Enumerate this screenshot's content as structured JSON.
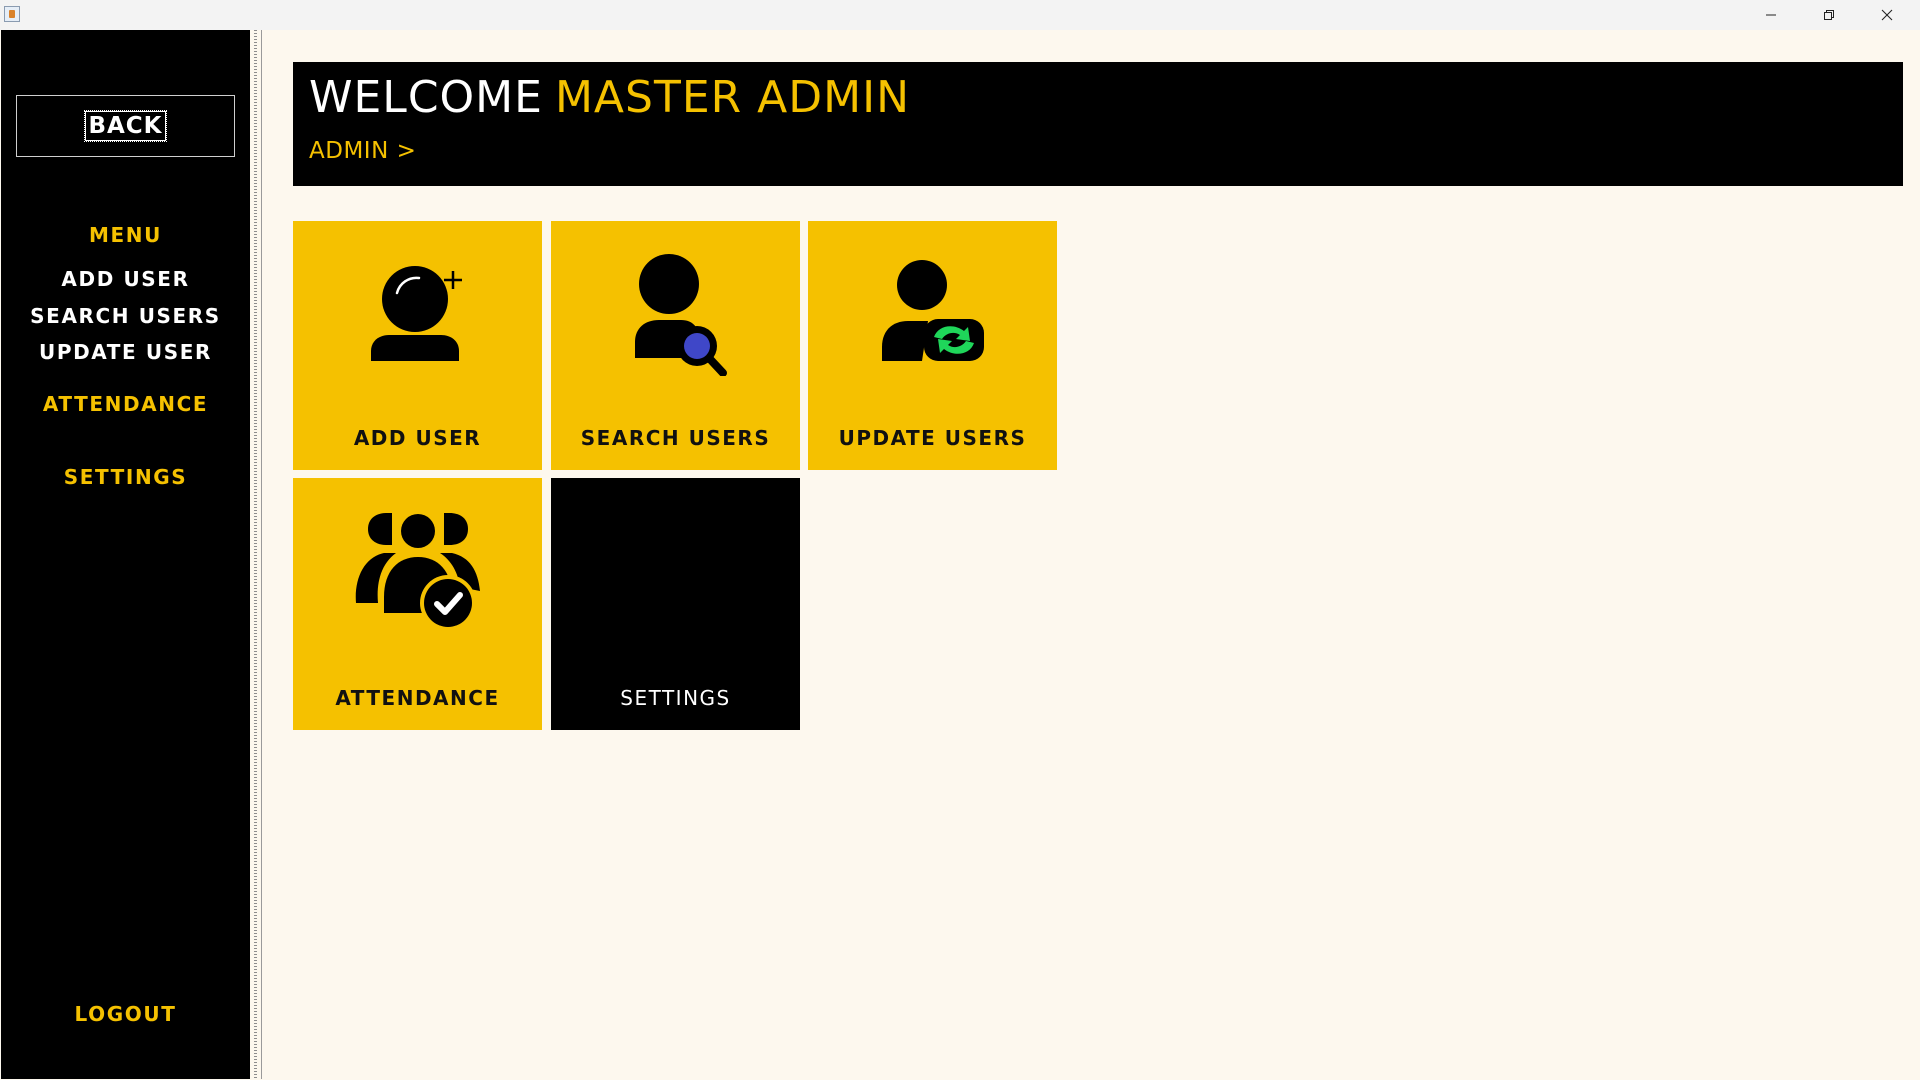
{
  "window": {
    "controls": {
      "minimize_icon": "minimize-icon",
      "restore_icon": "restore-icon",
      "close_icon": "close-icon"
    }
  },
  "sidebar": {
    "back_label": "BACK",
    "menu_heading": "MENU",
    "items": [
      {
        "label": "ADD USER",
        "color": "#ffffff"
      },
      {
        "label": "SEARCH USERS",
        "color": "#ffffff"
      },
      {
        "label": "UPDATE USER",
        "color": "#ffffff"
      }
    ],
    "attendance_label": "ATTENDANCE",
    "settings_label": "SETTINGS",
    "logout_label": "LOGOUT"
  },
  "header": {
    "welcome": "WELCOME",
    "name": "MASTER ADMIN",
    "breadcrumb": "ADMIN >"
  },
  "tiles": [
    {
      "label": "ADD USER",
      "icon": "add-user-icon"
    },
    {
      "label": "SEARCH USERS",
      "icon": "search-users-icon"
    },
    {
      "label": "UPDATE USERS",
      "icon": "update-users-icon"
    },
    {
      "label": "ATTENDANCE",
      "icon": "attendance-icon"
    },
    {
      "label": "SETTINGS",
      "icon": ""
    }
  ],
  "colors": {
    "accent": "#f5c100",
    "sidebar_bg": "#000000",
    "content_bg": "#fdf8ee",
    "search_lens": "#3f47c8",
    "update_arrows": "#1fd65a"
  }
}
